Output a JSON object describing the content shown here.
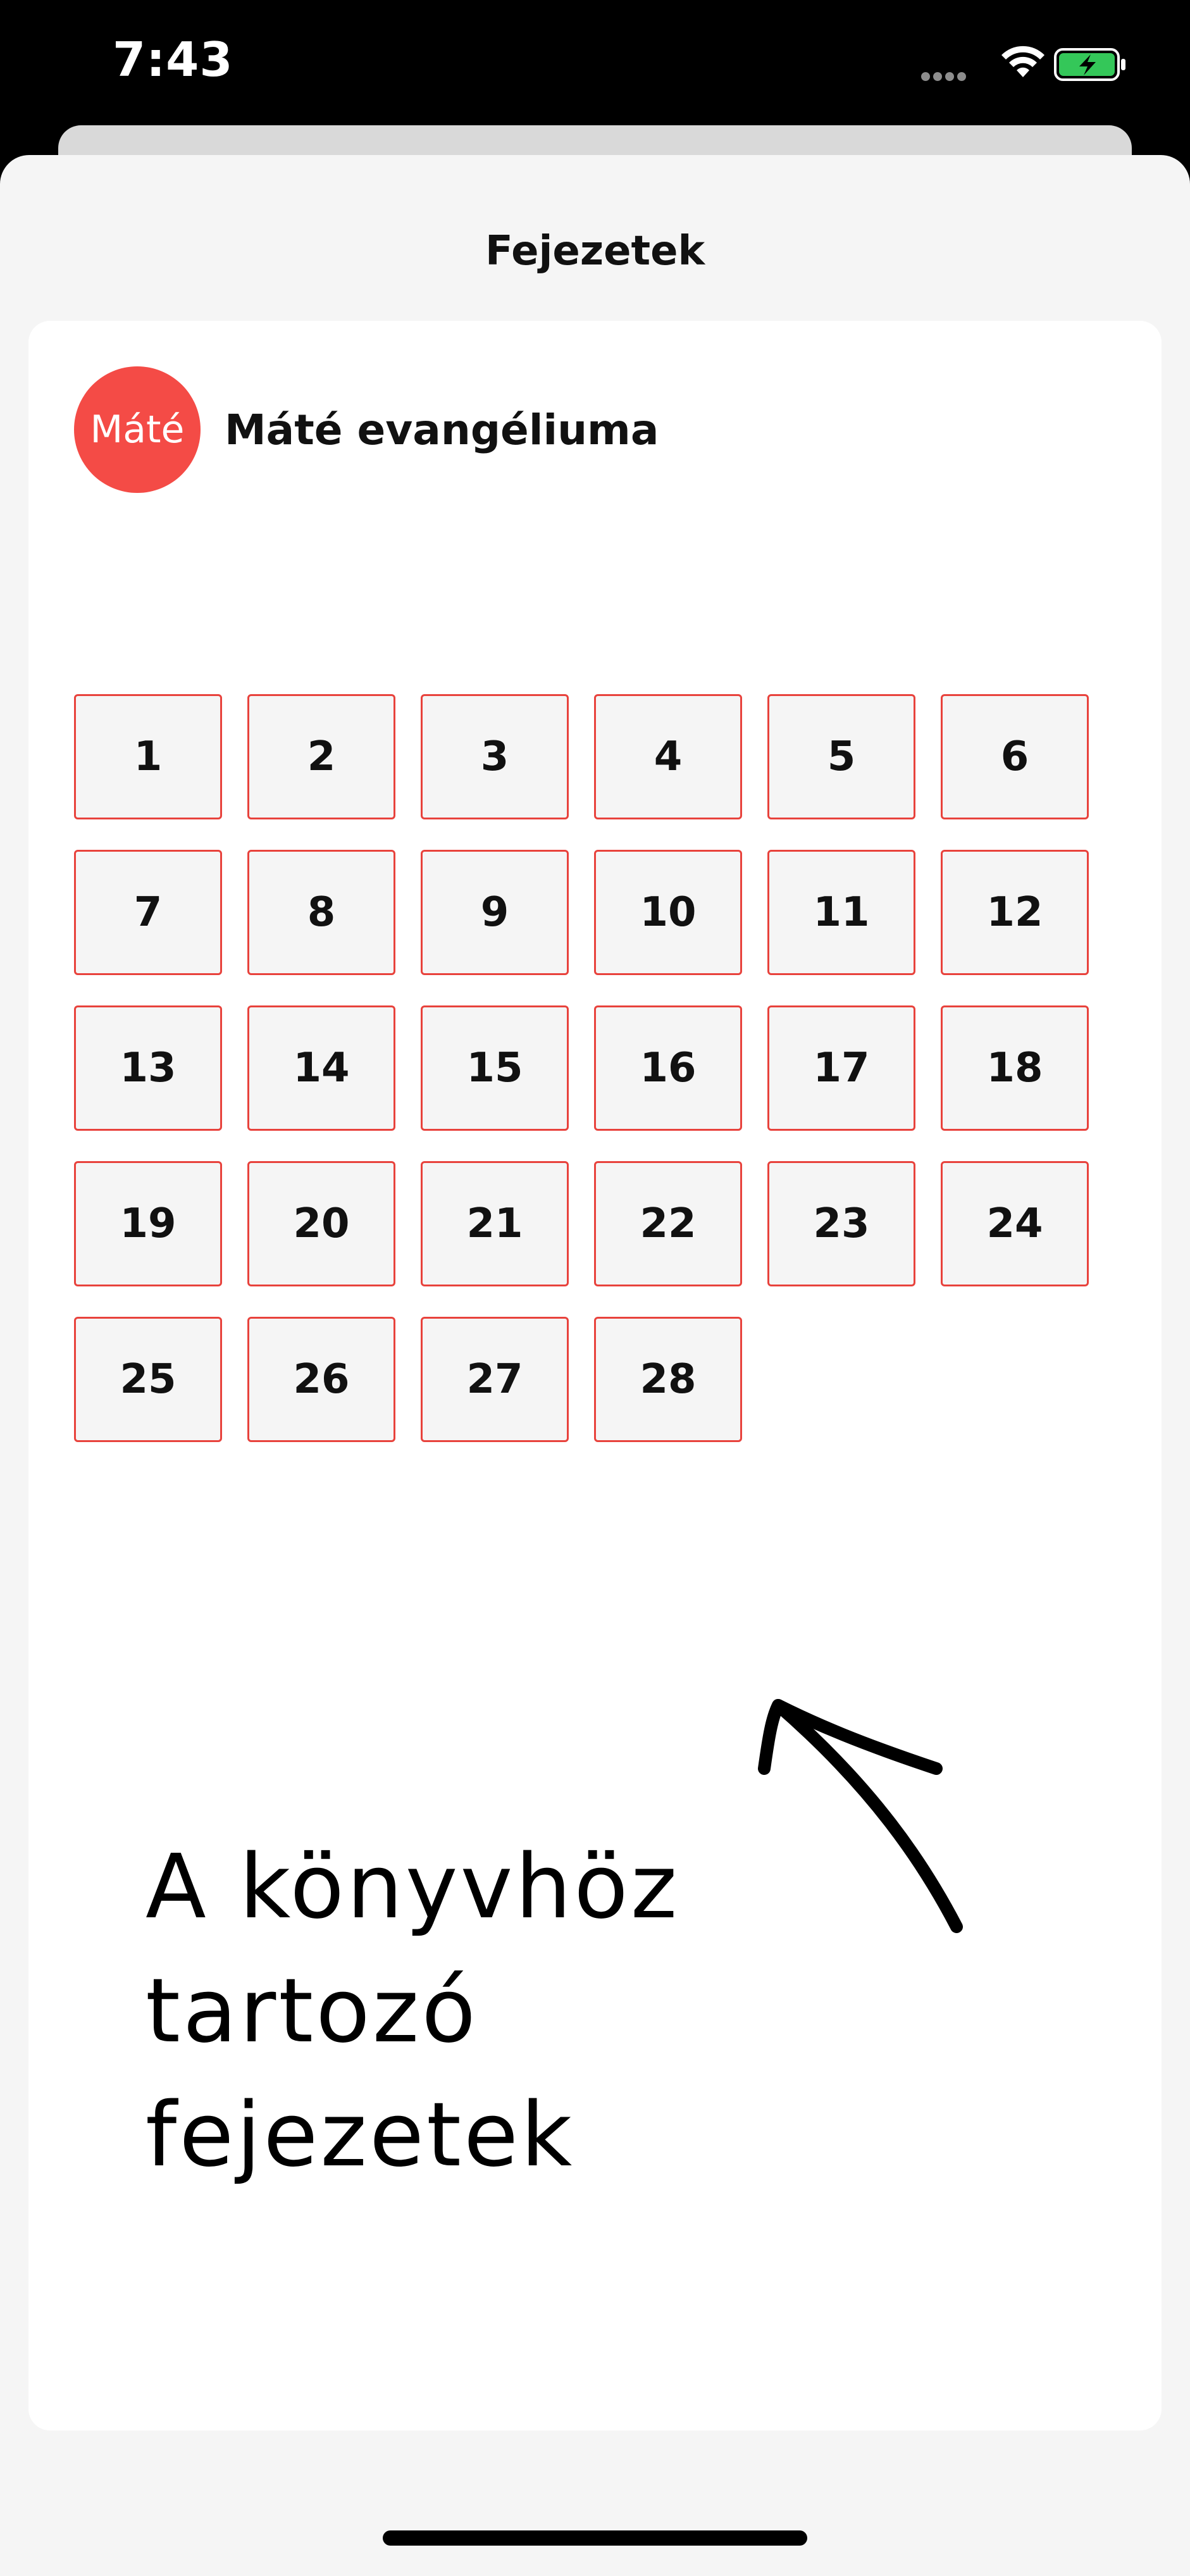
{
  "status_bar": {
    "time": "7:43",
    "icons": [
      "signal-icon",
      "wifi-icon",
      "battery-charging-icon"
    ],
    "battery_color": "#34c759"
  },
  "sheet": {
    "title": "Fejezetek"
  },
  "book": {
    "badge": "Máté",
    "badge_color": "#f44b46",
    "title": "Máté evangéliuma"
  },
  "chapters": [
    "1",
    "2",
    "3",
    "4",
    "5",
    "6",
    "7",
    "8",
    "9",
    "10",
    "11",
    "12",
    "13",
    "14",
    "15",
    "16",
    "17",
    "18",
    "19",
    "20",
    "21",
    "22",
    "23",
    "24",
    "25",
    "26",
    "27",
    "28"
  ],
  "chapter_border_color": "#e8423c",
  "annotation": {
    "line1": "A könyvhöz tartozó",
    "line2": "fejezetek"
  }
}
